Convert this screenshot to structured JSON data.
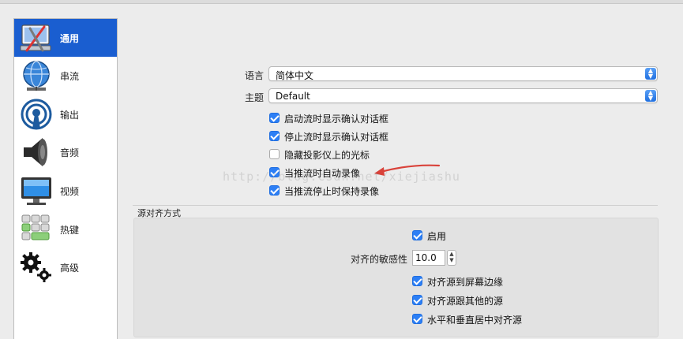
{
  "sidebar": {
    "items": [
      {
        "label": "通用",
        "icon": "general-settings-icon",
        "active": true
      },
      {
        "label": "串流",
        "icon": "stream-globe-icon",
        "active": false
      },
      {
        "label": "输出",
        "icon": "output-broadcast-icon",
        "active": false
      },
      {
        "label": "音频",
        "icon": "audio-speaker-icon",
        "active": false
      },
      {
        "label": "视频",
        "icon": "video-monitor-icon",
        "active": false
      },
      {
        "label": "热键",
        "icon": "hotkeys-keyboard-icon",
        "active": false
      },
      {
        "label": "高级",
        "icon": "advanced-gears-icon",
        "active": false
      }
    ]
  },
  "general": {
    "language_label": "语言",
    "language_value": "简体中文",
    "theme_label": "主题",
    "theme_value": "Default",
    "checkboxes": [
      {
        "label": "启动流时显示确认对话框",
        "checked": true
      },
      {
        "label": "停止流时显示确认对话框",
        "checked": true
      },
      {
        "label": "隐藏投影仪上的光标",
        "checked": false
      },
      {
        "label": "当推流时自动录像",
        "checked": true
      },
      {
        "label": "当推流停止时保持录像",
        "checked": true
      }
    ]
  },
  "snapping": {
    "group_title": "源对齐方式",
    "enable_label": "启用",
    "enable_checked": true,
    "sensitivity_label": "对齐的敏感性",
    "sensitivity_value": "10.0",
    "options": [
      {
        "label": "对齐源到屏幕边缘",
        "checked": true
      },
      {
        "label": "对齐源跟其他的源",
        "checked": true
      },
      {
        "label": "水平和垂直居中对齐源",
        "checked": true
      }
    ]
  },
  "watermark": "http://blog.csdn.net/xiejiashu",
  "colors": {
    "accent": "#1a5ed0",
    "checkbox": "#2d7ff5",
    "arrow": "#d9423a"
  }
}
